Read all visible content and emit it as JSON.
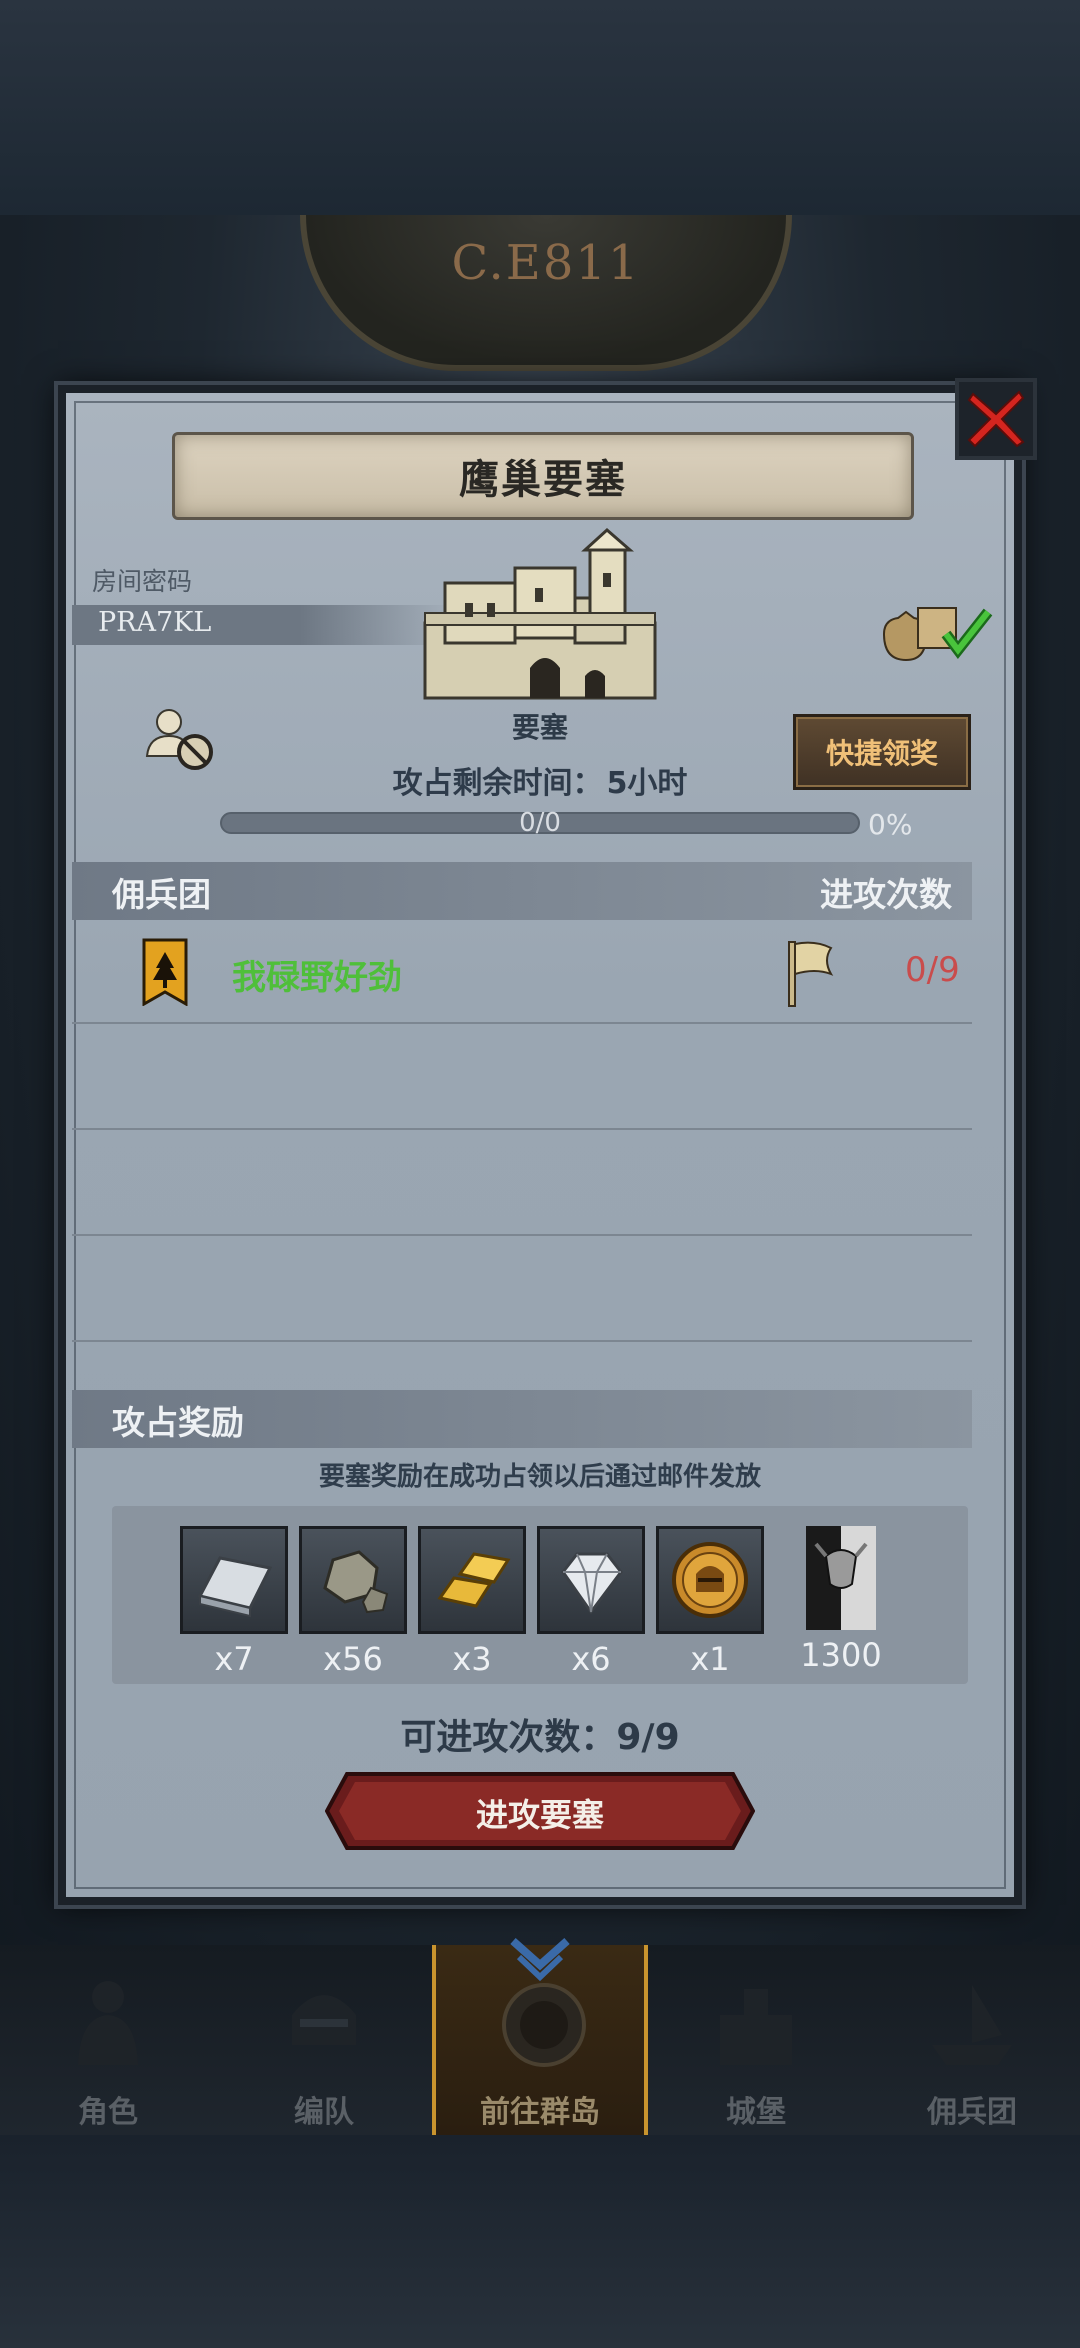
{
  "header": {
    "year": "C.E811"
  },
  "dialog": {
    "title": "鹰巢要塞",
    "room_label": "房间密码",
    "room_code": "PRA7KL",
    "fortress_name": "要塞",
    "time_label": "攻占剩余时间：",
    "time_value": "5小时",
    "progress_text": "0/0",
    "progress_percent": "0%",
    "progress_fraction": 0,
    "quick_claim_label": "快捷领奖",
    "mercenary_header": "佣兵团",
    "attacks_header": "进攻次数",
    "guild": {
      "name": "我碌野好劲",
      "attacks": "0/9"
    },
    "rewards_header": "攻占奖励",
    "rewards_note": "要塞奖励在成功占领以后通过邮件发放",
    "rewards": [
      {
        "icon": "silver-ingot-icon",
        "qty": "x7"
      },
      {
        "icon": "ore-stone-icon",
        "qty": "x56"
      },
      {
        "icon": "gold-bars-icon",
        "qty": "x3"
      },
      {
        "icon": "diamond-icon",
        "qty": "x6"
      },
      {
        "icon": "knight-medal-icon",
        "qty": "x1"
      },
      {
        "icon": "honor-banner-icon",
        "qty": "1300"
      }
    ],
    "attacks_remaining_label": "可进攻次数：",
    "attacks_remaining_value": "9/9",
    "attack_button_label": "进攻要塞"
  },
  "nav": [
    {
      "label": "角色",
      "icon": "knight-icon",
      "active": false
    },
    {
      "label": "编队",
      "icon": "helmet-icon",
      "active": false
    },
    {
      "label": "前往群岛",
      "icon": "compass-icon",
      "active": true
    },
    {
      "label": "城堡",
      "icon": "castle-icon",
      "active": false
    },
    {
      "label": "佣兵团",
      "icon": "ship-icon",
      "active": false
    }
  ],
  "colors": {
    "guild_name": "#4fbf3a",
    "attack_count": "#c94c4c",
    "quick_claim_text": "#f0c078",
    "close_x": "#d4251f"
  }
}
